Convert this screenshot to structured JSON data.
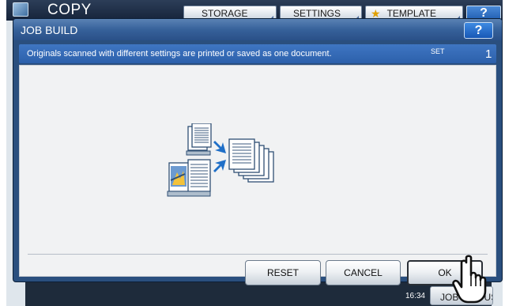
{
  "app": {
    "title": "COPY",
    "tabs": [
      {
        "label": "STORAGE"
      },
      {
        "label": "SETTINGS"
      },
      {
        "label": "TEMPLATE",
        "icon": "star-icon"
      }
    ],
    "help_label": "?",
    "time": "16:34",
    "job_status_label": "JOB STATUS"
  },
  "dialog": {
    "title": "JOB BUILD",
    "help_label": "?",
    "message": "Originals scanned with different settings are printed or saved as one document.",
    "set_label": "SET",
    "set_count": "1",
    "illustration_icon": "job-build-icon",
    "buttons": {
      "reset": "RESET",
      "cancel": "CANCEL",
      "ok": "OK"
    }
  },
  "colors": {
    "dialog_frame": "#2a4f7e",
    "info_bar": "#3a6cb8",
    "content_bg": "#f1f2f3",
    "arrow_blue": "#1f6fc8"
  },
  "cursor_icon": "pointing-hand-icon"
}
